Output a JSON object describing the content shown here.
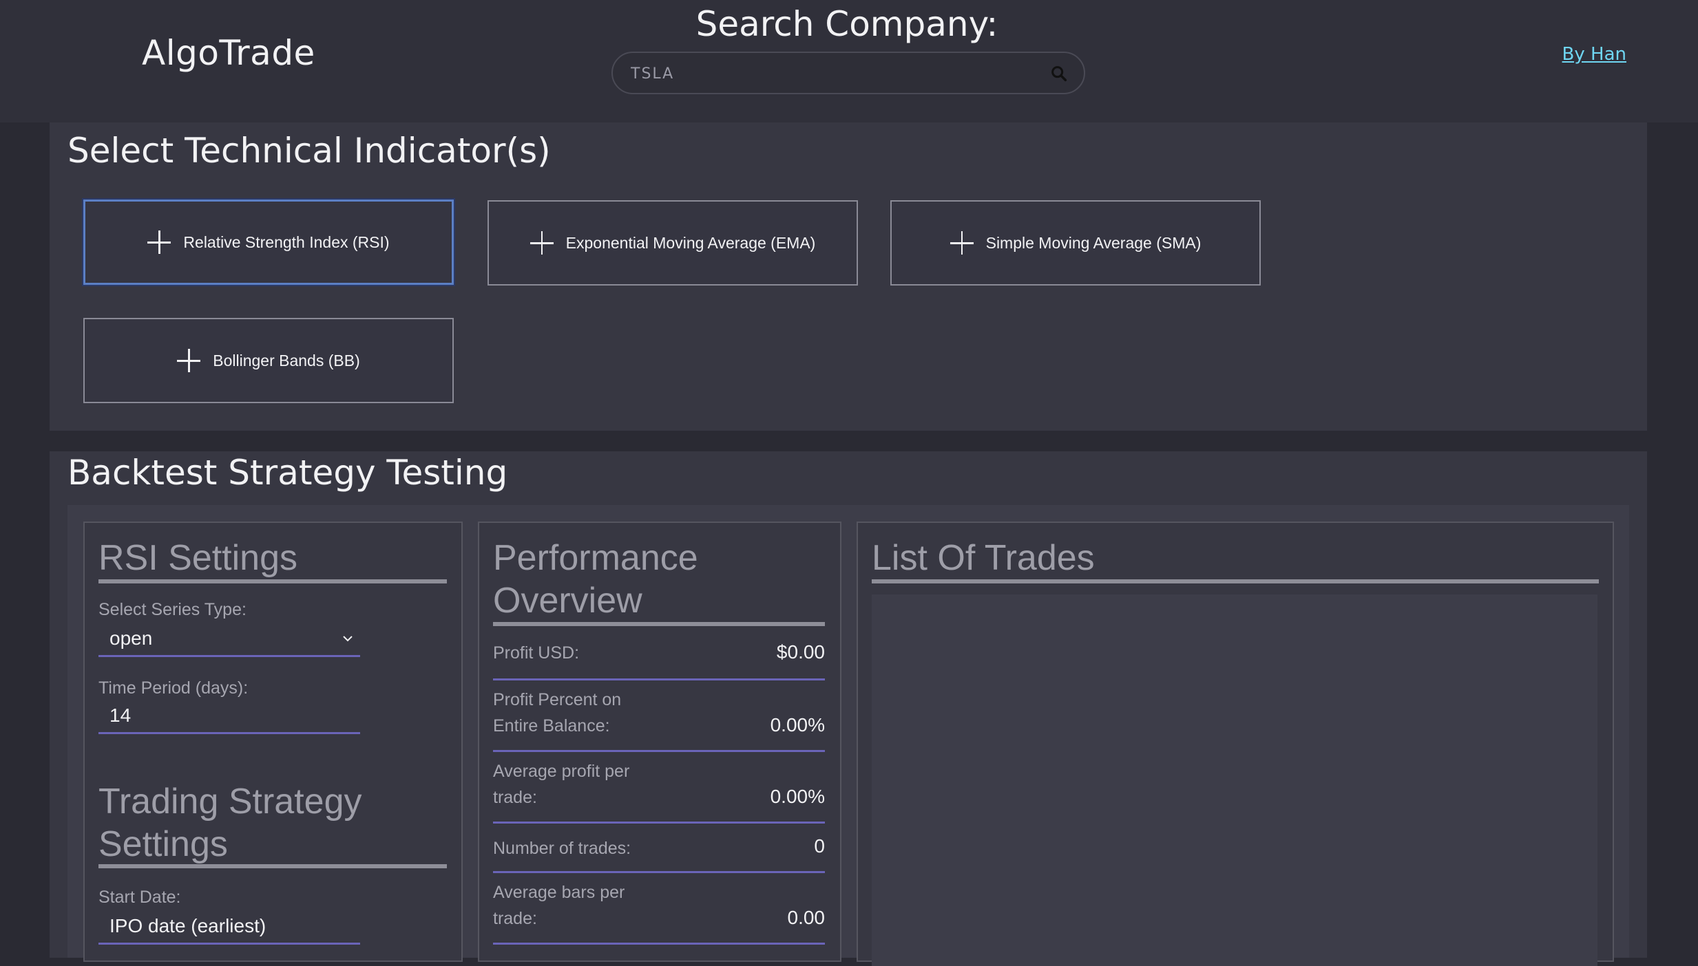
{
  "header": {
    "logo": "AlgoTrade",
    "search_title": "Search Company:",
    "search_value": "TSLA",
    "byline": "By Han"
  },
  "indicators": {
    "title": "Select Technical Indicator(s)",
    "buttons": [
      {
        "label": "Relative Strength Index (RSI)",
        "icon": "plus-icon"
      },
      {
        "label": "Exponential Moving Average (EMA)",
        "icon": "plus-icon"
      },
      {
        "label": "Simple Moving Average (SMA)",
        "icon": "plus-icon"
      },
      {
        "label": "Bollinger Bands (BB)",
        "icon": "plus-icon"
      }
    ]
  },
  "backtest": {
    "title": "Backtest Strategy Testing",
    "rsi_settings": {
      "title": "RSI Settings",
      "series_label": "Select Series Type:",
      "series_value": "open",
      "period_label": "Time Period (days):",
      "period_value": "14"
    },
    "strategy_settings": {
      "title_line1": "Trading Strategy",
      "title_line2": "Settings",
      "start_label": "Start Date:",
      "start_value": "IPO date (earliest)"
    },
    "performance": {
      "title_line1": "Performance",
      "title_line2": "Overview",
      "stats": [
        {
          "label_line1": "Profit USD:",
          "label_line2": "",
          "value": "$0.00"
        },
        {
          "label_line1": "Profit Percent on",
          "label_line2": "Entire Balance:",
          "value": "0.00%"
        },
        {
          "label_line1": "Average profit per",
          "label_line2": "trade:",
          "value": "0.00%"
        },
        {
          "label_line1": "Number of trades:",
          "label_line2": "",
          "value": "0"
        },
        {
          "label_line1": "Average bars per",
          "label_line2": "trade:",
          "value": "0.00"
        }
      ]
    },
    "trades": {
      "title": "List Of Trades"
    }
  },
  "colors": {
    "accent_underline": "#6a64b8",
    "link": "#6fd6f2",
    "focus": "#5b7fc4"
  }
}
